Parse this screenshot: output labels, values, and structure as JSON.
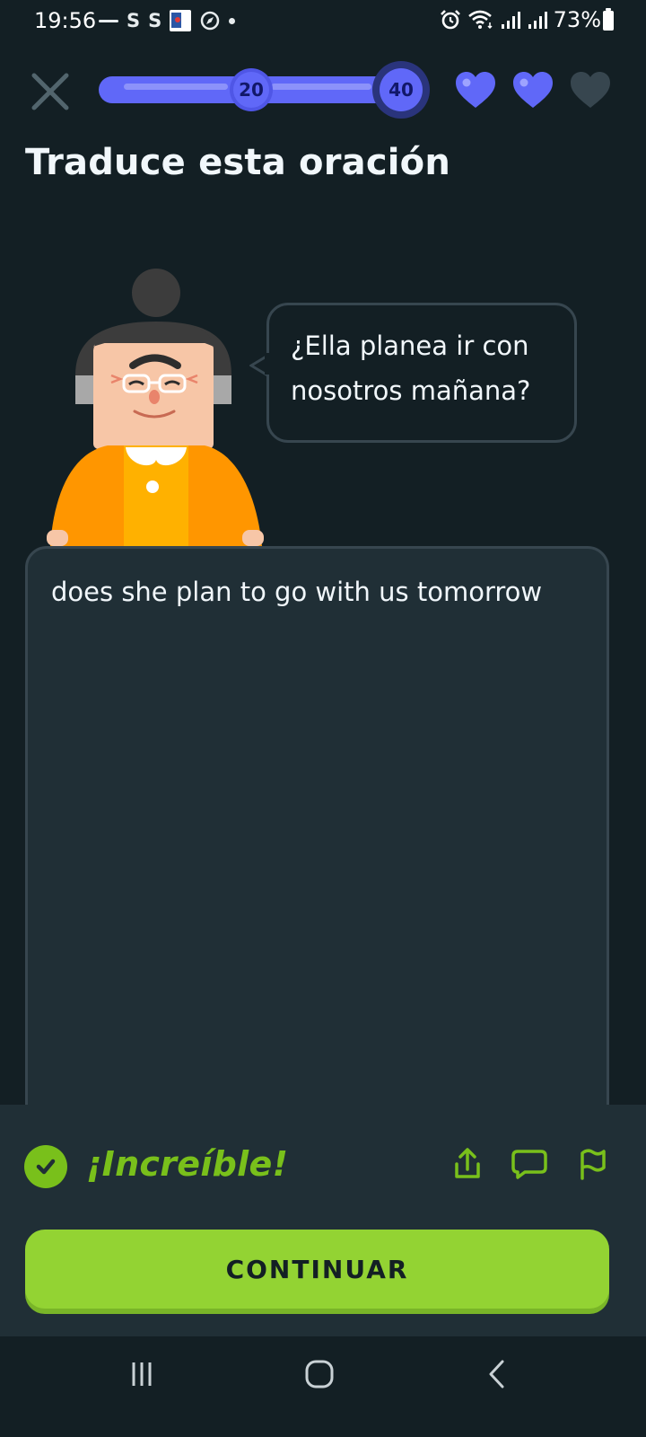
{
  "status_bar": {
    "time": "19:56",
    "battery": "73%",
    "icons": [
      "notification-dash-icon",
      "s-app-icon",
      "s-app-icon",
      "image-thumbnail-icon",
      "compass-icon",
      "dot-icon",
      "alarm-icon",
      "wifi-icon",
      "signal-icon",
      "signal-icon",
      "battery-icon"
    ]
  },
  "header": {
    "close_icon": "close-icon",
    "progress": {
      "fraction": 1.0,
      "milestones": [
        "20",
        "40"
      ]
    },
    "hearts": {
      "total": 3,
      "filled": 2,
      "filled_color": "#6068f8",
      "empty_color": "#37464f"
    }
  },
  "exercise": {
    "instruction": "Traduce esta oración",
    "prompt_line1": "¿Ella planea ir con",
    "prompt_line2": "nosotros mañana?",
    "answer": "does she plan to go with us tomorrow"
  },
  "feedback": {
    "title": "¡Increíble!",
    "status_icon": "check-icon",
    "actions": [
      "share-icon",
      "comment-icon",
      "flag-icon"
    ],
    "color": "#79c01b"
  },
  "continue_button": {
    "label": "CONTINUAR",
    "color": "#93d333"
  },
  "nav_bar": {
    "buttons": [
      "recent-apps-icon",
      "home-icon",
      "back-icon"
    ]
  }
}
